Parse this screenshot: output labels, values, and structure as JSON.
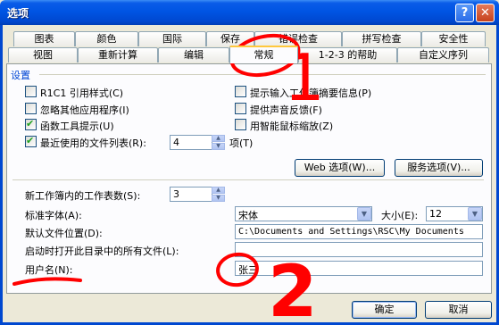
{
  "window": {
    "title": "选项",
    "help_glyph": "?",
    "close_glyph": "✕"
  },
  "tabs_row1": [
    "图表",
    "颜色",
    "国际",
    "保存",
    "错误检查",
    "拼写检查",
    "安全性"
  ],
  "tabs_row2": [
    "视图",
    "重新计算",
    "编辑",
    "常规",
    "1-2-3 的帮助",
    "自定义序列"
  ],
  "active_tab": "常规",
  "settings": {
    "group_label": "设置",
    "left_options": [
      {
        "label": "R1C1 引用样式(C)",
        "checked": false
      },
      {
        "label": "忽略其他应用程序(I)",
        "checked": false
      },
      {
        "label": "函数工具提示(U)",
        "checked": true
      },
      {
        "label": "最近使用的文件列表(R):",
        "checked": true
      }
    ],
    "right_options": [
      {
        "label": "提示输入工作簿摘要信息(P)",
        "checked": false
      },
      {
        "label": "提供声音反馈(F)",
        "checked": false
      },
      {
        "label": "用智能鼠标缩放(Z)",
        "checked": false
      }
    ],
    "recent_count": "4",
    "recent_unit": "项(T)",
    "web_options_button": "Web 选项(W)...",
    "service_options_button": "服务选项(V)..."
  },
  "general": {
    "sheets_label": "新工作簿内的工作表数(S):",
    "sheets_value": "3",
    "font_label": "标准字体(A):",
    "font_value": "宋体",
    "size_label": "大小(E):",
    "size_value": "12",
    "default_path_label": "默认文件位置(D):",
    "default_path_value": "C:\\Documents and Settings\\RSC\\My Documents",
    "startup_label": "启动时打开此目录中的所有文件(L):",
    "startup_value": "",
    "username_label": "用户名(N):",
    "username_value": "张三"
  },
  "buttons": {
    "ok": "确定",
    "cancel": "取消"
  },
  "annotations": {
    "color": "#FF0000",
    "digit_one": "1",
    "digit_two": "2"
  }
}
